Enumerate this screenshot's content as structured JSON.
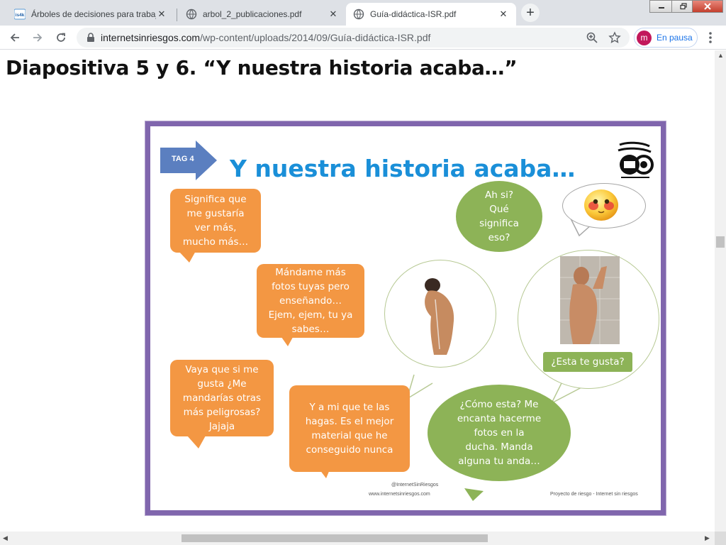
{
  "browser": {
    "tabs": [
      {
        "title": "Árboles de decisiones para trabajo",
        "favicon": "is4k-favicon",
        "active": false
      },
      {
        "title": "arbol_2_publicaciones.pdf",
        "favicon": "globe-icon",
        "active": false
      },
      {
        "title": "Guía-didáctica-ISR.pdf",
        "favicon": "globe-icon",
        "active": true
      }
    ],
    "favicon_text": "is4k",
    "url_host": "internetsinriesgos.com",
    "url_path": "/wp-content/uploads/2014/09/Guía-didáctica-ISR.pdf",
    "profile_initial": "m",
    "profile_status": "En pausa",
    "close_symbol": "✕",
    "new_tab_symbol": "+"
  },
  "document": {
    "heading": "Diapositiva 5 y 6. “Y nuestra historia acaba…”"
  },
  "slide": {
    "title": "Y nuestra historia acaba…",
    "tag": "TAG 4",
    "bubbles": {
      "orange_1": [
        "Significa que",
        "me gustaría",
        "ver más,",
        "mucho más…"
      ],
      "orange_2": [
        "Mándame más",
        "fotos tuyas pero",
        "enseñando…",
        "Ejem, ejem, tu ya",
        "sabes…"
      ],
      "orange_3": [
        "Vaya que si me",
        "gusta ¿Me",
        "mandarías otras",
        "más peligrosas?",
        "Jajaja"
      ],
      "orange_4": [
        "Y a mi que te las",
        "hagas. Es el mejor",
        "material que he",
        "conseguido nunca"
      ],
      "green_1": [
        "Ah si?",
        "Qué",
        "significa",
        "eso?"
      ],
      "green_2": [
        "¿Esta te gusta?"
      ],
      "green_3": [
        "¿Cómo esta? Me",
        "encanta hacerme",
        "fotos en la",
        "ducha. Manda",
        "alguna tu anda…"
      ]
    },
    "footer_left_1": "@InternetSinRiesgos",
    "footer_left_2": "www.internetsinriesgos.com",
    "footer_right": "Proyecto de riesgo - Internet sin riesgos"
  },
  "colors": {
    "slide_border": "#8066ad",
    "orange": "#f39743",
    "green": "#8db357",
    "title_blue": "#1a8fd8",
    "tag_blue": "#5b7fc0"
  }
}
